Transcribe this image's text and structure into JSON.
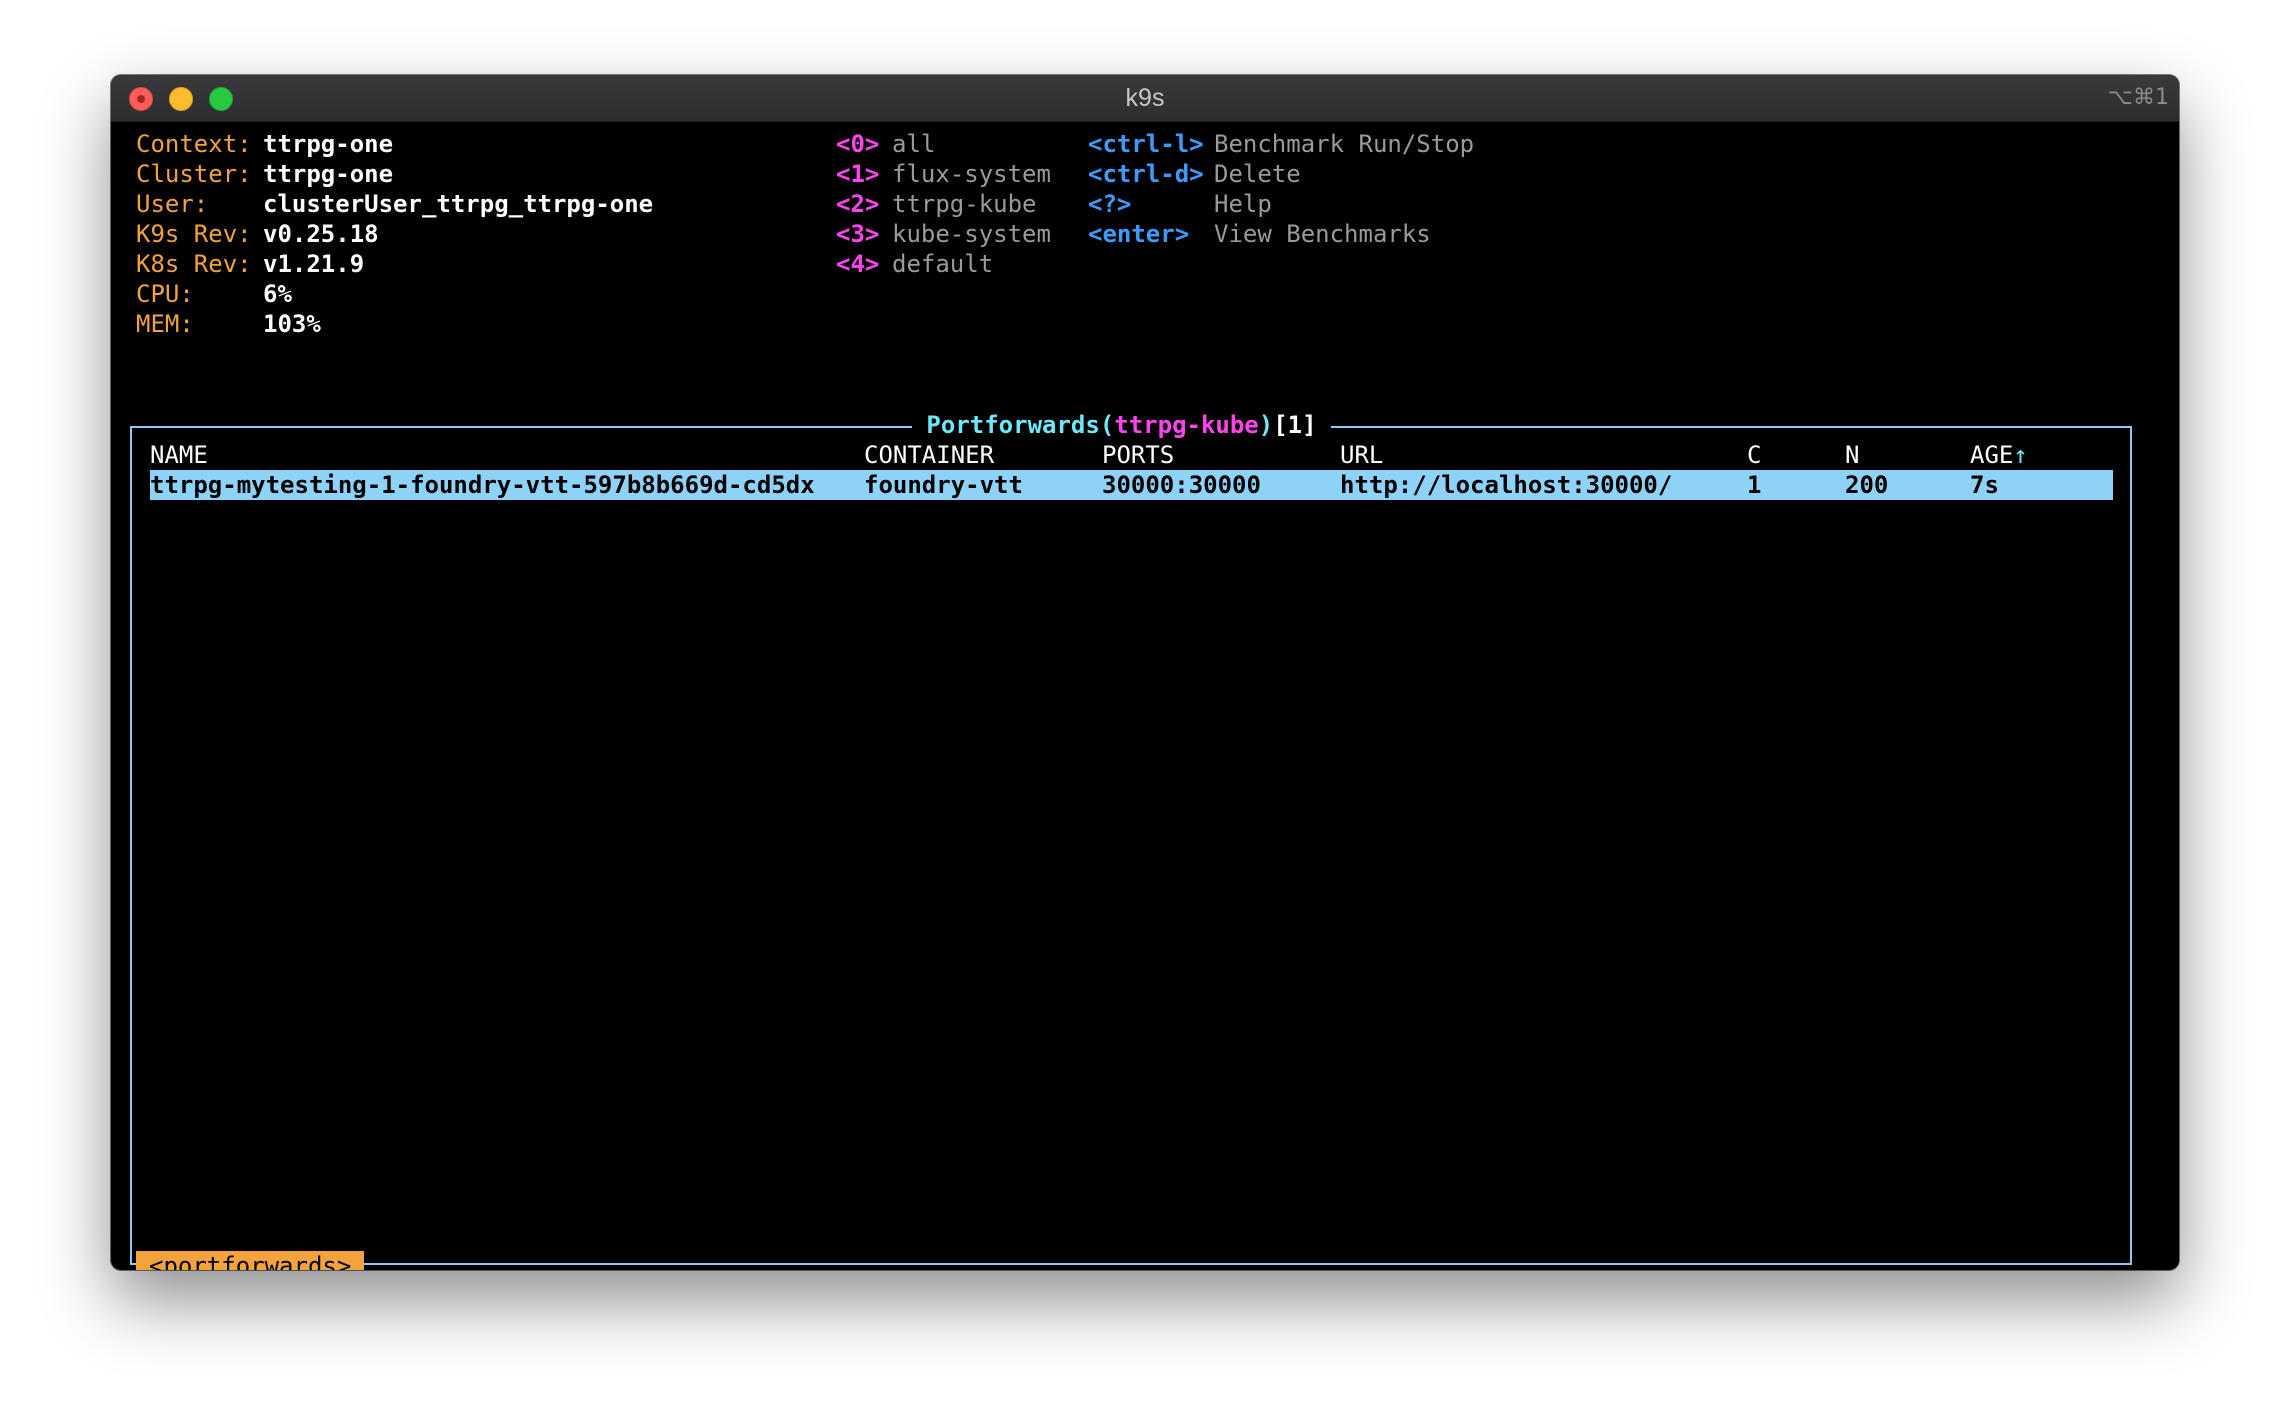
{
  "window": {
    "title": "k9s",
    "shortcut": "⌥⌘1"
  },
  "info": [
    {
      "label": "Context:",
      "value": "ttrpg-one"
    },
    {
      "label": "Cluster:",
      "value": "ttrpg-one"
    },
    {
      "label": "User:",
      "value": "clusterUser_ttrpg_ttrpg-one"
    },
    {
      "label": "K9s Rev:",
      "value": "v0.25.18"
    },
    {
      "label": "K8s Rev:",
      "value": "v1.21.9"
    },
    {
      "label": "CPU:",
      "value": "6%"
    },
    {
      "label": "MEM:",
      "value": "103%"
    }
  ],
  "namespaces": [
    {
      "key": "<0>",
      "label": "all"
    },
    {
      "key": "<1>",
      "label": "flux-system"
    },
    {
      "key": "<2>",
      "label": "ttrpg-kube"
    },
    {
      "key": "<3>",
      "label": "kube-system"
    },
    {
      "key": "<4>",
      "label": "default"
    }
  ],
  "actions": [
    {
      "key": "<ctrl-l>",
      "label": "Benchmark Run/Stop"
    },
    {
      "key": "<ctrl-d>",
      "label": "Delete"
    },
    {
      "key": "<?>",
      "label": "Help"
    },
    {
      "key": "<enter>",
      "label": "View Benchmarks"
    }
  ],
  "panel": {
    "title": "Portforwards",
    "namespace": "ttrpg-kube",
    "count": "[1]",
    "open_paren": "(",
    "close_paren": ")"
  },
  "table": {
    "headers": [
      "NAME",
      "CONTAINER",
      "PORTS",
      "URL",
      "C",
      "N",
      "AGE"
    ],
    "sort_indicator": "↑",
    "rows": [
      [
        "ttrpg-mytesting-1-foundry-vtt-597b8b669d-cd5dx",
        "foundry-vtt",
        "30000:30000",
        "http://localhost:30000/",
        "1",
        "200",
        "7s"
      ]
    ]
  },
  "breadcrumb": "<portforwards>",
  "colors": {
    "label": "#f2a33c",
    "namespace_key": "#ff44ee",
    "action_key": "#3d9bff",
    "frame": "#8ec9f5",
    "selected_row": "#8fd2f7"
  }
}
